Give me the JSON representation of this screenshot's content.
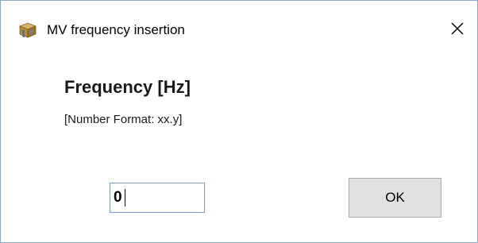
{
  "window": {
    "title": "MV frequency insertion",
    "app_icon": "package-icon",
    "close_icon": "close-icon"
  },
  "content": {
    "heading": "Frequency [Hz]",
    "format_note": "[Number Format: xx.y]"
  },
  "frequency_input": {
    "value": "0"
  },
  "ok_button": {
    "label": "OK"
  },
  "colors": {
    "window_border": "#8aa8c8",
    "input_border": "#7a9cd3",
    "button_face": "#e1e1e1",
    "button_border": "#adadad"
  }
}
